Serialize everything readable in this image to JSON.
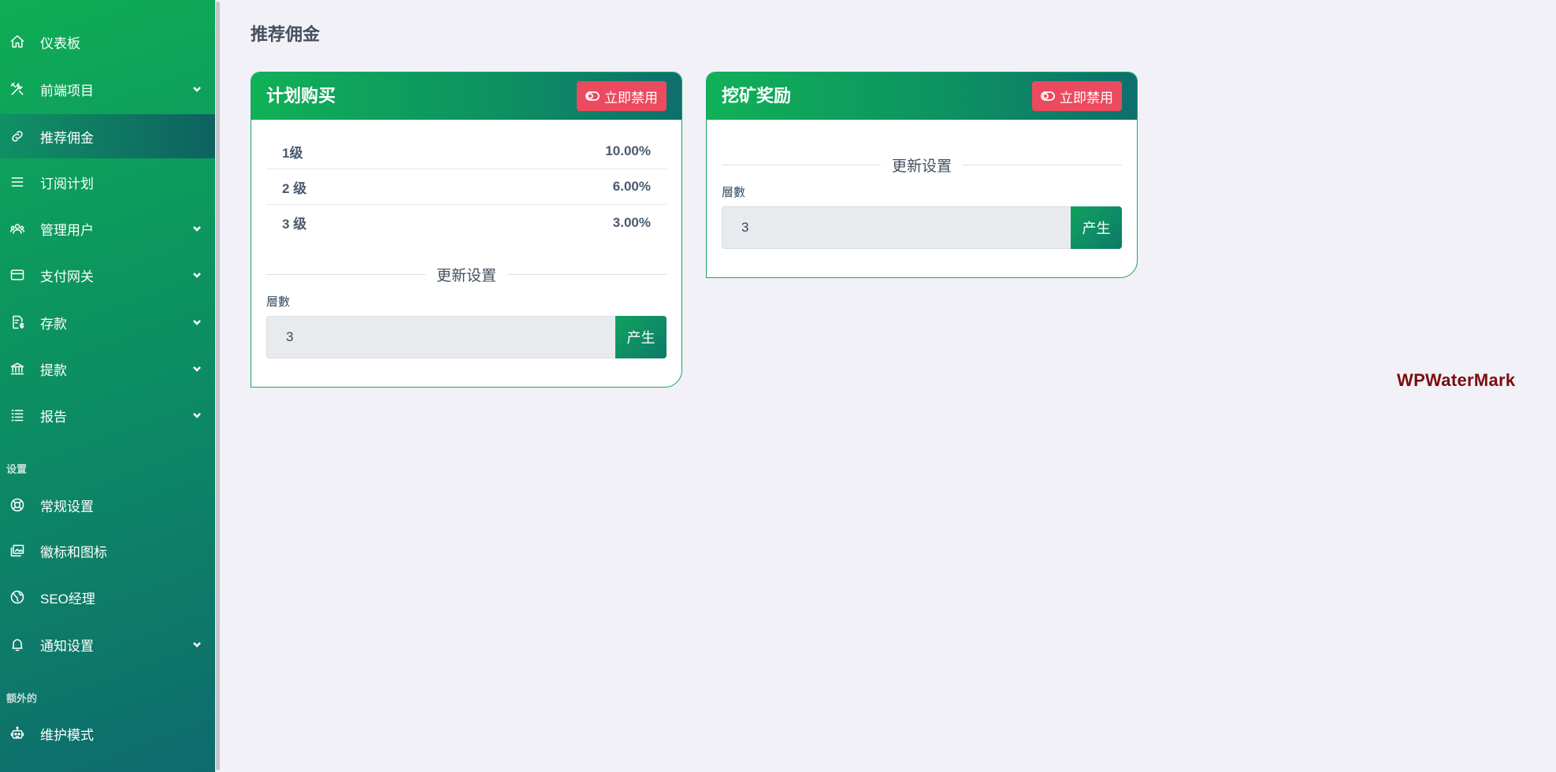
{
  "sidebar": {
    "items": [
      {
        "label": "仪表板",
        "icon": "home-icon",
        "has_children": false
      },
      {
        "label": "前端项目",
        "icon": "tools-icon",
        "has_children": true
      },
      {
        "label": "推荐佣金",
        "icon": "link-icon",
        "has_children": false,
        "active": true
      },
      {
        "label": "订阅计划",
        "icon": "list-icon",
        "has_children": false
      },
      {
        "label": "管理用户",
        "icon": "users-icon",
        "has_children": true
      },
      {
        "label": "支付网关",
        "icon": "credit-card-icon",
        "has_children": true
      },
      {
        "label": "存款",
        "icon": "deposit-doc-icon",
        "has_children": true
      },
      {
        "label": "提款",
        "icon": "bank-icon",
        "has_children": true
      },
      {
        "label": "报告",
        "icon": "report-list-icon",
        "has_children": true
      }
    ],
    "settings_section_label": "设置",
    "settings_items": [
      {
        "label": "常规设置",
        "icon": "lifebuoy-icon",
        "has_children": false
      },
      {
        "label": "徽标和图标",
        "icon": "images-icon",
        "has_children": false
      },
      {
        "label": "SEO经理",
        "icon": "globe-icon",
        "has_children": false
      },
      {
        "label": "通知设置",
        "icon": "bell-icon",
        "has_children": true
      }
    ],
    "extra_section_label": "额外的",
    "extra_items": [
      {
        "label": "维护模式",
        "icon": "robot-icon",
        "has_children": false
      }
    ]
  },
  "main": {
    "page_title": "推荐佣金",
    "cards": [
      {
        "title": "计划购买",
        "disable_label": "立即禁用",
        "levels": [
          {
            "level": "1级",
            "percent": "10.00%"
          },
          {
            "level": "2 级",
            "percent": "6.00%"
          },
          {
            "level": "3 级",
            "percent": "3.00%"
          }
        ],
        "update_title": "更新设置",
        "field_label": "層數",
        "field_value": "3",
        "generate_label": "产生"
      },
      {
        "title": "挖矿奖励",
        "disable_label": "立即禁用",
        "update_title": "更新设置",
        "field_label": "層數",
        "field_value": "3",
        "generate_label": "产生"
      }
    ]
  },
  "watermark": "WPWaterMark",
  "colors": {
    "sidebar_start": "#0ead55",
    "sidebar_end": "#0f6a6e",
    "danger": "#ec4a5f",
    "page_bg": "#f1f1f7"
  }
}
